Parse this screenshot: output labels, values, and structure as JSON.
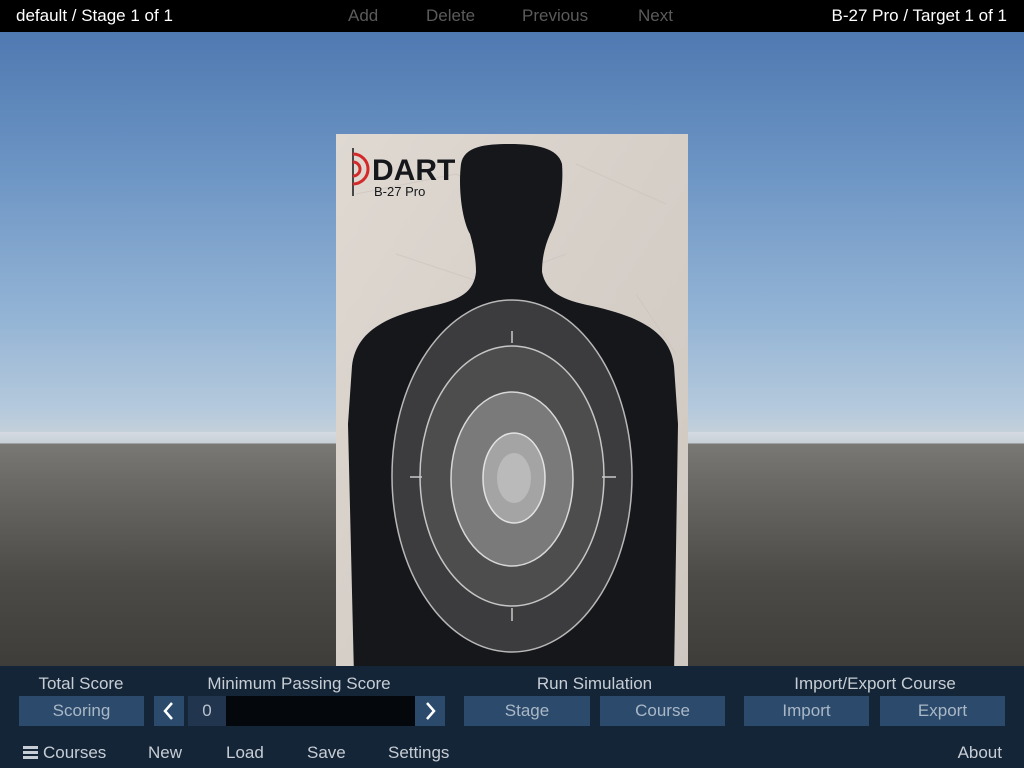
{
  "topbar": {
    "stage_title": "default / Stage 1 of 1",
    "actions": {
      "add": "Add",
      "delete": "Delete",
      "previous": "Previous",
      "next": "Next"
    },
    "target_title": "B-27 Pro / Target 1 of 1"
  },
  "target": {
    "brand": "DART",
    "model": "B-27 Pro"
  },
  "panel": {
    "total_score": {
      "header": "Total Score",
      "button": "Scoring"
    },
    "min_passing": {
      "header": "Minimum Passing Score",
      "value": "0",
      "left_icon": "chevron-left-icon",
      "right_icon": "chevron-right-icon"
    },
    "run_simulation": {
      "header": "Run Simulation",
      "stage": "Stage",
      "course": "Course"
    },
    "import_export": {
      "header": "Import/Export Course",
      "import": "Import",
      "export": "Export"
    }
  },
  "bottombar": {
    "menu_icon": "hamburger-icon",
    "courses": "Courses",
    "new": "New",
    "load": "Load",
    "save": "Save",
    "settings": "Settings",
    "about": "About"
  },
  "colors": {
    "bar_bg": "#000000",
    "panel_bg": "#152538",
    "button_bg": "#2c4a6c",
    "disabled_text": "#5b5b5b",
    "silhouette": "#15171b",
    "paper": "#d9d3cc",
    "brand_red": "#d4292a"
  }
}
